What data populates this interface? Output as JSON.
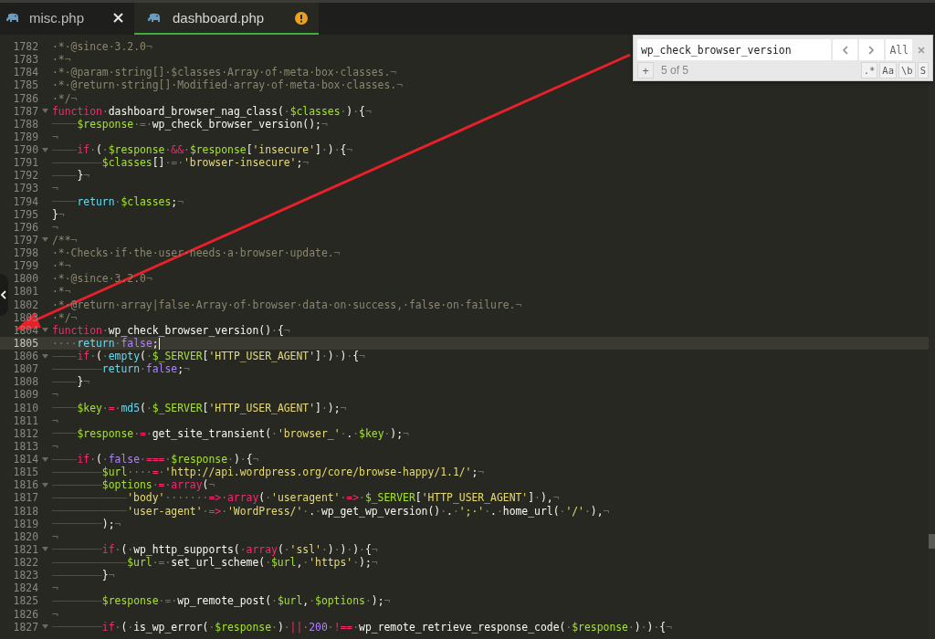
{
  "tabs": [
    {
      "label": "misc.php",
      "selected": false,
      "kind": "closable"
    },
    {
      "label": "dashboard.php",
      "selected": true,
      "kind": "modified"
    }
  ],
  "editor": {
    "lines": [
      {
        "number": "1782",
        "foldable": false,
        "current": false,
        "tokens": [
          {
            "kind": "comment",
            "text": "·*·@since·3.2.0"
          },
          {
            "kind": "eol",
            "text": "¬"
          }
        ]
      },
      {
        "number": "1783",
        "foldable": false,
        "current": false,
        "tokens": [
          {
            "kind": "comment",
            "text": "·*"
          },
          {
            "kind": "eol",
            "text": "¬"
          }
        ]
      },
      {
        "number": "1784",
        "foldable": false,
        "current": false,
        "tokens": [
          {
            "kind": "comment",
            "text": "·*·@param·string[]·$classes·Array·of·meta·box·classes."
          },
          {
            "kind": "eol",
            "text": "¬"
          }
        ]
      },
      {
        "number": "1785",
        "foldable": false,
        "current": false,
        "tokens": [
          {
            "kind": "comment",
            "text": "·*·@return·string[]·Modified·array·of·meta·box·classes."
          },
          {
            "kind": "eol",
            "text": "¬"
          }
        ]
      },
      {
        "number": "1786",
        "foldable": false,
        "current": false,
        "tokens": [
          {
            "kind": "comment",
            "text": "·*/"
          },
          {
            "kind": "eol",
            "text": "¬"
          }
        ]
      },
      {
        "number": "1787",
        "foldable": true,
        "current": false,
        "tokens": [
          {
            "kind": "keyword",
            "text": "function"
          },
          {
            "kind": "space",
            "text": "·"
          },
          {
            "kind": "plain",
            "text": "dashboard_browser_nag_class("
          },
          {
            "kind": "space",
            "text": "·"
          },
          {
            "kind": "variable",
            "text": "$classes"
          },
          {
            "kind": "space",
            "text": "·"
          },
          {
            "kind": "plain",
            "text": ")"
          },
          {
            "kind": "space",
            "text": "·"
          },
          {
            "kind": "plain",
            "text": "{"
          },
          {
            "kind": "eol",
            "text": "¬"
          }
        ]
      },
      {
        "number": "1788",
        "foldable": false,
        "current": false,
        "tokens": [
          {
            "kind": "tab"
          },
          {
            "kind": "variable",
            "text": "$response"
          },
          {
            "kind": "space",
            "text": "·"
          },
          {
            "kind": "keyword",
            "text": "="
          },
          {
            "kind": "space",
            "text": "·"
          },
          {
            "kind": "plain",
            "text": "wp_check_browser_version();"
          },
          {
            "kind": "eol",
            "text": "¬"
          }
        ]
      },
      {
        "number": "1789",
        "foldable": false,
        "current": false,
        "tokens": [
          {
            "kind": "eol",
            "text": "¬"
          }
        ]
      },
      {
        "number": "1790",
        "foldable": true,
        "current": false,
        "tokens": [
          {
            "kind": "tab"
          },
          {
            "kind": "keyword",
            "text": "if"
          },
          {
            "kind": "space",
            "text": "·"
          },
          {
            "kind": "plain",
            "text": "("
          },
          {
            "kind": "space",
            "text": "·"
          },
          {
            "kind": "variable",
            "text": "$response"
          },
          {
            "kind": "space",
            "text": "·"
          },
          {
            "kind": "keyword",
            "text": "&&"
          },
          {
            "kind": "space",
            "text": "·"
          },
          {
            "kind": "variable",
            "text": "$response"
          },
          {
            "kind": "plain",
            "text": "["
          },
          {
            "kind": "string",
            "text": "'insecure'"
          },
          {
            "kind": "plain",
            "text": "]"
          },
          {
            "kind": "space",
            "text": "·"
          },
          {
            "kind": "plain",
            "text": ")"
          },
          {
            "kind": "space",
            "text": "·"
          },
          {
            "kind": "plain",
            "text": "{"
          },
          {
            "kind": "eol",
            "text": "¬"
          }
        ]
      },
      {
        "number": "1791",
        "foldable": false,
        "current": false,
        "tokens": [
          {
            "kind": "tab"
          },
          {
            "kind": "tab"
          },
          {
            "kind": "variable",
            "text": "$classes"
          },
          {
            "kind": "plain",
            "text": "[]"
          },
          {
            "kind": "space",
            "text": "·"
          },
          {
            "kind": "keyword",
            "text": "="
          },
          {
            "kind": "space",
            "text": "·"
          },
          {
            "kind": "string",
            "text": "'browser-insecure'"
          },
          {
            "kind": "plain",
            "text": ";"
          },
          {
            "kind": "eol",
            "text": "¬"
          }
        ]
      },
      {
        "number": "1792",
        "foldable": false,
        "current": false,
        "tokens": [
          {
            "kind": "tab"
          },
          {
            "kind": "plain",
            "text": "}"
          },
          {
            "kind": "eol",
            "text": "¬"
          }
        ]
      },
      {
        "number": "1793",
        "foldable": false,
        "current": false,
        "tokens": [
          {
            "kind": "eol",
            "text": "¬"
          }
        ]
      },
      {
        "number": "1794",
        "foldable": false,
        "current": false,
        "tokens": [
          {
            "kind": "tab"
          },
          {
            "kind": "builtin",
            "text": "return"
          },
          {
            "kind": "space",
            "text": "·"
          },
          {
            "kind": "variable",
            "text": "$classes"
          },
          {
            "kind": "plain",
            "text": ";"
          },
          {
            "kind": "eol",
            "text": "¬"
          }
        ]
      },
      {
        "number": "1795",
        "foldable": false,
        "current": false,
        "tokens": [
          {
            "kind": "plain",
            "text": "}"
          },
          {
            "kind": "eol",
            "text": "¬"
          }
        ]
      },
      {
        "number": "1796",
        "foldable": false,
        "current": false,
        "tokens": [
          {
            "kind": "eol",
            "text": "¬"
          }
        ]
      },
      {
        "number": "1797",
        "foldable": true,
        "current": false,
        "tokens": [
          {
            "kind": "comment",
            "text": "/**"
          },
          {
            "kind": "eol",
            "text": "¬"
          }
        ]
      },
      {
        "number": "1798",
        "foldable": false,
        "current": false,
        "tokens": [
          {
            "kind": "comment",
            "text": "·*·Checks·if·the·user·needs·a·browser·update."
          },
          {
            "kind": "eol",
            "text": "¬"
          }
        ]
      },
      {
        "number": "1799",
        "foldable": false,
        "current": false,
        "tokens": [
          {
            "kind": "comment",
            "text": "·*"
          },
          {
            "kind": "eol",
            "text": "¬"
          }
        ]
      },
      {
        "number": "1800",
        "foldable": false,
        "current": false,
        "tokens": [
          {
            "kind": "comment",
            "text": "·*·@since·3.2.0"
          },
          {
            "kind": "eol",
            "text": "¬"
          }
        ]
      },
      {
        "number": "1801",
        "foldable": false,
        "current": false,
        "tokens": [
          {
            "kind": "comment",
            "text": "·*"
          },
          {
            "kind": "eol",
            "text": "¬"
          }
        ]
      },
      {
        "number": "1802",
        "foldable": false,
        "current": false,
        "tokens": [
          {
            "kind": "comment",
            "text": "·*·@return·array|false·Array·of·browser·data·on·success,·false·on·failure."
          },
          {
            "kind": "eol",
            "text": "¬"
          }
        ]
      },
      {
        "number": "1803",
        "foldable": false,
        "current": false,
        "tokens": [
          {
            "kind": "comment",
            "text": "·*/"
          },
          {
            "kind": "eol",
            "text": "¬"
          }
        ]
      },
      {
        "number": "1804",
        "foldable": true,
        "current": false,
        "tokens": [
          {
            "kind": "keyword",
            "text": "function"
          },
          {
            "kind": "space",
            "text": "·"
          },
          {
            "kind": "plain",
            "text": "wp_check_browser_version()"
          },
          {
            "kind": "space",
            "text": "·"
          },
          {
            "kind": "plain",
            "text": "{"
          },
          {
            "kind": "eol",
            "text": "¬"
          }
        ]
      },
      {
        "number": "1805",
        "foldable": false,
        "current": true,
        "tokens": [
          {
            "kind": "space",
            "text": "····"
          },
          {
            "kind": "builtin",
            "text": "return"
          },
          {
            "kind": "space",
            "text": "·"
          },
          {
            "kind": "constant",
            "text": "false"
          },
          {
            "kind": "plain",
            "text": ";"
          }
        ]
      },
      {
        "number": "1806",
        "foldable": true,
        "current": false,
        "tokens": [
          {
            "kind": "tab"
          },
          {
            "kind": "keyword",
            "text": "if"
          },
          {
            "kind": "space",
            "text": "·"
          },
          {
            "kind": "plain",
            "text": "("
          },
          {
            "kind": "space",
            "text": "·"
          },
          {
            "kind": "builtin",
            "text": "empty"
          },
          {
            "kind": "plain",
            "text": "("
          },
          {
            "kind": "space",
            "text": "·"
          },
          {
            "kind": "variable",
            "text": "$_SERVER"
          },
          {
            "kind": "plain",
            "text": "["
          },
          {
            "kind": "string",
            "text": "'HTTP_USER_AGENT'"
          },
          {
            "kind": "plain",
            "text": "]"
          },
          {
            "kind": "space",
            "text": "·"
          },
          {
            "kind": "plain",
            "text": ")"
          },
          {
            "kind": "space",
            "text": "·"
          },
          {
            "kind": "plain",
            "text": ")"
          },
          {
            "kind": "space",
            "text": "·"
          },
          {
            "kind": "plain",
            "text": "{"
          },
          {
            "kind": "eol",
            "text": "¬"
          }
        ]
      },
      {
        "number": "1807",
        "foldable": false,
        "current": false,
        "tokens": [
          {
            "kind": "tab"
          },
          {
            "kind": "tab"
          },
          {
            "kind": "builtin",
            "text": "return"
          },
          {
            "kind": "space",
            "text": "·"
          },
          {
            "kind": "constant",
            "text": "false"
          },
          {
            "kind": "plain",
            "text": ";"
          },
          {
            "kind": "eol",
            "text": "¬"
          }
        ]
      },
      {
        "number": "1808",
        "foldable": false,
        "current": false,
        "tokens": [
          {
            "kind": "tab"
          },
          {
            "kind": "plain",
            "text": "}"
          },
          {
            "kind": "eol",
            "text": "¬"
          }
        ]
      },
      {
        "number": "1809",
        "foldable": false,
        "current": false,
        "tokens": [
          {
            "kind": "eol",
            "text": "¬"
          }
        ]
      },
      {
        "number": "1810",
        "foldable": false,
        "current": false,
        "tokens": [
          {
            "kind": "tab"
          },
          {
            "kind": "variable",
            "text": "$key"
          },
          {
            "kind": "space",
            "text": "·"
          },
          {
            "kind": "keyword",
            "text": "="
          },
          {
            "kind": "space",
            "text": "·"
          },
          {
            "kind": "builtin",
            "text": "md5"
          },
          {
            "kind": "plain",
            "text": "("
          },
          {
            "kind": "space",
            "text": "·"
          },
          {
            "kind": "variable",
            "text": "$_SERVER"
          },
          {
            "kind": "plain",
            "text": "["
          },
          {
            "kind": "string",
            "text": "'HTTP_USER_AGENT'"
          },
          {
            "kind": "plain",
            "text": "]"
          },
          {
            "kind": "space",
            "text": "·"
          },
          {
            "kind": "plain",
            "text": ");"
          },
          {
            "kind": "eol",
            "text": "¬"
          }
        ]
      },
      {
        "number": "1811",
        "foldable": false,
        "current": false,
        "tokens": [
          {
            "kind": "eol",
            "text": "¬"
          }
        ]
      },
      {
        "number": "1812",
        "foldable": false,
        "current": false,
        "tokens": [
          {
            "kind": "tab"
          },
          {
            "kind": "variable",
            "text": "$response"
          },
          {
            "kind": "space",
            "text": "·"
          },
          {
            "kind": "keyword",
            "text": "="
          },
          {
            "kind": "space",
            "text": "·"
          },
          {
            "kind": "plain",
            "text": "get_site_transient("
          },
          {
            "kind": "space",
            "text": "·"
          },
          {
            "kind": "string",
            "text": "'browser_'"
          },
          {
            "kind": "space",
            "text": "·"
          },
          {
            "kind": "plain",
            "text": "."
          },
          {
            "kind": "space",
            "text": "·"
          },
          {
            "kind": "variable",
            "text": "$key"
          },
          {
            "kind": "space",
            "text": "·"
          },
          {
            "kind": "plain",
            "text": ");"
          },
          {
            "kind": "eol",
            "text": "¬"
          }
        ]
      },
      {
        "number": "1813",
        "foldable": false,
        "current": false,
        "tokens": [
          {
            "kind": "eol",
            "text": "¬"
          }
        ]
      },
      {
        "number": "1814",
        "foldable": true,
        "current": false,
        "tokens": [
          {
            "kind": "tab"
          },
          {
            "kind": "keyword",
            "text": "if"
          },
          {
            "kind": "space",
            "text": "·"
          },
          {
            "kind": "plain",
            "text": "("
          },
          {
            "kind": "space",
            "text": "·"
          },
          {
            "kind": "constant",
            "text": "false"
          },
          {
            "kind": "space",
            "text": "·"
          },
          {
            "kind": "keyword",
            "text": "==="
          },
          {
            "kind": "space",
            "text": "·"
          },
          {
            "kind": "variable",
            "text": "$response"
          },
          {
            "kind": "space",
            "text": "·"
          },
          {
            "kind": "plain",
            "text": ")"
          },
          {
            "kind": "space",
            "text": "·"
          },
          {
            "kind": "plain",
            "text": "{"
          },
          {
            "kind": "eol",
            "text": "¬"
          }
        ]
      },
      {
        "number": "1815",
        "foldable": false,
        "current": false,
        "tokens": [
          {
            "kind": "tab"
          },
          {
            "kind": "tab"
          },
          {
            "kind": "variable",
            "text": "$url"
          },
          {
            "kind": "space",
            "text": "····"
          },
          {
            "kind": "keyword",
            "text": "="
          },
          {
            "kind": "space",
            "text": "·"
          },
          {
            "kind": "string",
            "text": "'http://api.wordpress.org/core/browse-happy/1.1/'"
          },
          {
            "kind": "plain",
            "text": ";"
          },
          {
            "kind": "eol",
            "text": "¬"
          }
        ]
      },
      {
        "number": "1816",
        "foldable": true,
        "current": false,
        "tokens": [
          {
            "kind": "tab"
          },
          {
            "kind": "tab"
          },
          {
            "kind": "variable",
            "text": "$options"
          },
          {
            "kind": "space",
            "text": "·"
          },
          {
            "kind": "keyword",
            "text": "="
          },
          {
            "kind": "space",
            "text": "·"
          },
          {
            "kind": "keyword",
            "text": "array"
          },
          {
            "kind": "plain",
            "text": "("
          },
          {
            "kind": "eol",
            "text": "¬"
          }
        ]
      },
      {
        "number": "1817",
        "foldable": false,
        "current": false,
        "tokens": [
          {
            "kind": "tab"
          },
          {
            "kind": "tab"
          },
          {
            "kind": "tab"
          },
          {
            "kind": "string",
            "text": "'body'"
          },
          {
            "kind": "space",
            "text": "·······"
          },
          {
            "kind": "keyword",
            "text": "=>"
          },
          {
            "kind": "space",
            "text": "·"
          },
          {
            "kind": "keyword",
            "text": "array"
          },
          {
            "kind": "plain",
            "text": "("
          },
          {
            "kind": "space",
            "text": "·"
          },
          {
            "kind": "string",
            "text": "'useragent'"
          },
          {
            "kind": "space",
            "text": "·"
          },
          {
            "kind": "keyword",
            "text": "=>"
          },
          {
            "kind": "space",
            "text": "·"
          },
          {
            "kind": "variable",
            "text": "$_SERVER"
          },
          {
            "kind": "plain",
            "text": "["
          },
          {
            "kind": "string",
            "text": "'HTTP_USER_AGENT'"
          },
          {
            "kind": "plain",
            "text": "]"
          },
          {
            "kind": "space",
            "text": "·"
          },
          {
            "kind": "plain",
            "text": "),"
          },
          {
            "kind": "eol",
            "text": "¬"
          }
        ]
      },
      {
        "number": "1818",
        "foldable": false,
        "current": false,
        "tokens": [
          {
            "kind": "tab"
          },
          {
            "kind": "tab"
          },
          {
            "kind": "tab"
          },
          {
            "kind": "string",
            "text": "'user-agent'"
          },
          {
            "kind": "space",
            "text": "·"
          },
          {
            "kind": "keyword",
            "text": "=>"
          },
          {
            "kind": "space",
            "text": "·"
          },
          {
            "kind": "string",
            "text": "'WordPress/'"
          },
          {
            "kind": "space",
            "text": "·"
          },
          {
            "kind": "plain",
            "text": "."
          },
          {
            "kind": "space",
            "text": "·"
          },
          {
            "kind": "plain",
            "text": "wp_get_wp_version()"
          },
          {
            "kind": "space",
            "text": "·"
          },
          {
            "kind": "plain",
            "text": "."
          },
          {
            "kind": "space",
            "text": "·"
          },
          {
            "kind": "string",
            "text": "';·'"
          },
          {
            "kind": "space",
            "text": "·"
          },
          {
            "kind": "plain",
            "text": "."
          },
          {
            "kind": "space",
            "text": "·"
          },
          {
            "kind": "plain",
            "text": "home_url("
          },
          {
            "kind": "space",
            "text": "·"
          },
          {
            "kind": "string",
            "text": "'/'"
          },
          {
            "kind": "space",
            "text": "·"
          },
          {
            "kind": "plain",
            "text": "),"
          },
          {
            "kind": "eol",
            "text": "¬"
          }
        ]
      },
      {
        "number": "1819",
        "foldable": false,
        "current": false,
        "tokens": [
          {
            "kind": "tab"
          },
          {
            "kind": "tab"
          },
          {
            "kind": "plain",
            "text": ");"
          },
          {
            "kind": "eol",
            "text": "¬"
          }
        ]
      },
      {
        "number": "1820",
        "foldable": false,
        "current": false,
        "tokens": [
          {
            "kind": "eol",
            "text": "¬"
          }
        ]
      },
      {
        "number": "1821",
        "foldable": true,
        "current": false,
        "tokens": [
          {
            "kind": "tab"
          },
          {
            "kind": "tab"
          },
          {
            "kind": "keyword",
            "text": "if"
          },
          {
            "kind": "space",
            "text": "·"
          },
          {
            "kind": "plain",
            "text": "("
          },
          {
            "kind": "space",
            "text": "·"
          },
          {
            "kind": "plain",
            "text": "wp_http_supports("
          },
          {
            "kind": "space",
            "text": "·"
          },
          {
            "kind": "keyword",
            "text": "array"
          },
          {
            "kind": "plain",
            "text": "("
          },
          {
            "kind": "space",
            "text": "·"
          },
          {
            "kind": "string",
            "text": "'ssl'"
          },
          {
            "kind": "space",
            "text": "·"
          },
          {
            "kind": "plain",
            "text": ")"
          },
          {
            "kind": "space",
            "text": "·"
          },
          {
            "kind": "plain",
            "text": ")"
          },
          {
            "kind": "space",
            "text": "·"
          },
          {
            "kind": "plain",
            "text": ")"
          },
          {
            "kind": "space",
            "text": "·"
          },
          {
            "kind": "plain",
            "text": "{"
          },
          {
            "kind": "eol",
            "text": "¬"
          }
        ]
      },
      {
        "number": "1822",
        "foldable": false,
        "current": false,
        "tokens": [
          {
            "kind": "tab"
          },
          {
            "kind": "tab"
          },
          {
            "kind": "tab"
          },
          {
            "kind": "variable",
            "text": "$url"
          },
          {
            "kind": "space",
            "text": "·"
          },
          {
            "kind": "keyword",
            "text": "="
          },
          {
            "kind": "space",
            "text": "·"
          },
          {
            "kind": "plain",
            "text": "set_url_scheme("
          },
          {
            "kind": "space",
            "text": "·"
          },
          {
            "kind": "variable",
            "text": "$url"
          },
          {
            "kind": "plain",
            "text": ","
          },
          {
            "kind": "space",
            "text": "·"
          },
          {
            "kind": "string",
            "text": "'https'"
          },
          {
            "kind": "space",
            "text": "·"
          },
          {
            "kind": "plain",
            "text": ");"
          },
          {
            "kind": "eol",
            "text": "¬"
          }
        ]
      },
      {
        "number": "1823",
        "foldable": false,
        "current": false,
        "tokens": [
          {
            "kind": "tab"
          },
          {
            "kind": "tab"
          },
          {
            "kind": "plain",
            "text": "}"
          },
          {
            "kind": "eol",
            "text": "¬"
          }
        ]
      },
      {
        "number": "1824",
        "foldable": false,
        "current": false,
        "tokens": [
          {
            "kind": "eol",
            "text": "¬"
          }
        ]
      },
      {
        "number": "1825",
        "foldable": false,
        "current": false,
        "tokens": [
          {
            "kind": "tab"
          },
          {
            "kind": "tab"
          },
          {
            "kind": "variable",
            "text": "$response"
          },
          {
            "kind": "space",
            "text": "·"
          },
          {
            "kind": "keyword",
            "text": "="
          },
          {
            "kind": "space",
            "text": "·"
          },
          {
            "kind": "plain",
            "text": "wp_remote_post("
          },
          {
            "kind": "space",
            "text": "·"
          },
          {
            "kind": "variable",
            "text": "$url"
          },
          {
            "kind": "plain",
            "text": ","
          },
          {
            "kind": "space",
            "text": "·"
          },
          {
            "kind": "variable",
            "text": "$options"
          },
          {
            "kind": "space",
            "text": "·"
          },
          {
            "kind": "plain",
            "text": ");"
          },
          {
            "kind": "eol",
            "text": "¬"
          }
        ]
      },
      {
        "number": "1826",
        "foldable": false,
        "current": false,
        "tokens": [
          {
            "kind": "eol",
            "text": "¬"
          }
        ]
      },
      {
        "number": "1827",
        "foldable": true,
        "current": false,
        "tokens": [
          {
            "kind": "tab"
          },
          {
            "kind": "tab"
          },
          {
            "kind": "keyword",
            "text": "if"
          },
          {
            "kind": "space",
            "text": "·"
          },
          {
            "kind": "plain",
            "text": "("
          },
          {
            "kind": "space",
            "text": "·"
          },
          {
            "kind": "plain",
            "text": "is_wp_error("
          },
          {
            "kind": "space",
            "text": "·"
          },
          {
            "kind": "variable",
            "text": "$response"
          },
          {
            "kind": "space",
            "text": "·"
          },
          {
            "kind": "plain",
            "text": ")"
          },
          {
            "kind": "space",
            "text": "·"
          },
          {
            "kind": "keyword",
            "text": "||"
          },
          {
            "kind": "space",
            "text": "·"
          },
          {
            "kind": "constant",
            "text": "200"
          },
          {
            "kind": "space",
            "text": "·"
          },
          {
            "kind": "keyword",
            "text": "!=="
          },
          {
            "kind": "space",
            "text": "·"
          },
          {
            "kind": "plain",
            "text": "wp_remote_retrieve_response_code("
          },
          {
            "kind": "space",
            "text": "·"
          },
          {
            "kind": "variable",
            "text": "$response"
          },
          {
            "kind": "space",
            "text": "·"
          },
          {
            "kind": "plain",
            "text": ")"
          },
          {
            "kind": "space",
            "text": "·"
          },
          {
            "kind": "plain",
            "text": ")"
          },
          {
            "kind": "space",
            "text": "·"
          },
          {
            "kind": "plain",
            "text": "{"
          },
          {
            "kind": "eol",
            "text": "¬"
          }
        ]
      }
    ]
  },
  "find_panel": {
    "query": "wp_check_browser_version",
    "all_button": "All",
    "add_button": "+",
    "match_count": "5 of 5",
    "options": [
      ".*",
      "Aa",
      "\\b",
      "S"
    ]
  }
}
